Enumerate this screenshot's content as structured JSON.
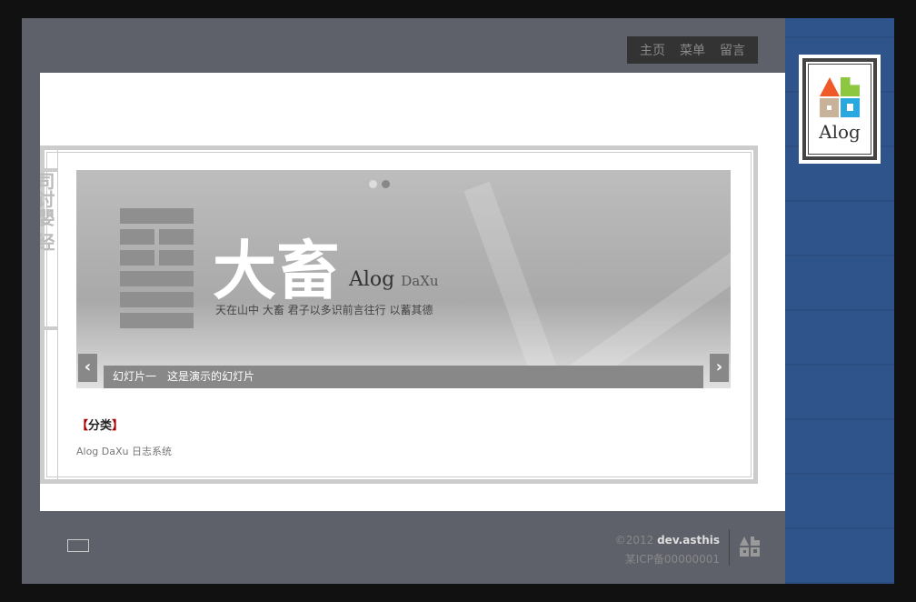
{
  "nav": {
    "items": [
      "主页",
      "菜单",
      "留言"
    ]
  },
  "logo": {
    "text": "Alog",
    "colors": {
      "orange": "#f05a28",
      "green": "#8dc63f",
      "tan": "#c8b29a",
      "blue": "#29a8e0"
    }
  },
  "strip": {
    "text": "司讨嬰 经"
  },
  "slider": {
    "title": "大畜",
    "brand": "Alog",
    "brand_sub": "DaXu",
    "motto": "天在山中 大畜 君子以多识前言往行 以蓄其德",
    "caption": "幻灯片一　这是演示的幻灯片",
    "prev": "‹",
    "next": "›",
    "active_slide": 2,
    "slide_count": 2
  },
  "category": {
    "open": "【",
    "label": "分类",
    "close": "】",
    "description": "Alog DaXu 日志系统"
  },
  "footer": {
    "copyright": "©2012",
    "author": "dev.asthis",
    "icp": "某ICP备00000001"
  }
}
